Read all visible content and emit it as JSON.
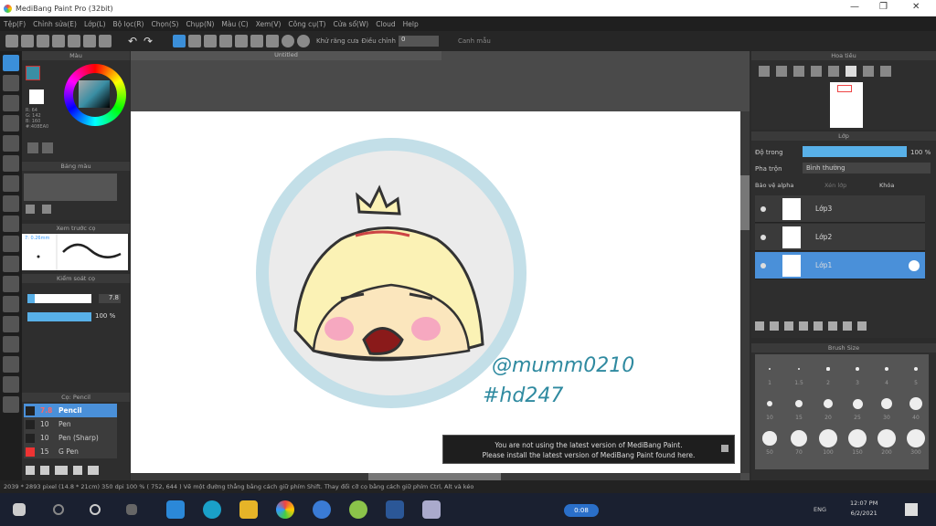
{
  "window": {
    "title": "MediBang Paint Pro (32bit)",
    "controls": [
      "—",
      "❐",
      "✕"
    ]
  },
  "menu": [
    "Tệp(F)",
    "Chỉnh sửa(E)",
    "Lớp(L)",
    "Bộ lọc(R)",
    "Chọn(S)",
    "Chụp(N)",
    "Màu (C)",
    "Xem(V)",
    "Công cụ(T)",
    "Cửa sổ(W)",
    "Cloud",
    "Help"
  ],
  "toolbar": {
    "antialias_label": "Khử răng cưa",
    "correction_label": "Điều chỉnh",
    "correction_value": "0",
    "snap_label": "Canh mẫu"
  },
  "document": {
    "tab": "Untitled",
    "signature_line1": "@mumm0210",
    "signature_line2": "#hd247"
  },
  "color_panel": {
    "title": "Màu",
    "r": "R: 64",
    "g": "G: 142",
    "b": "B: 160",
    "hex": "#:408EA0",
    "primary": "#3a8ea4"
  },
  "palette_panel": {
    "title": "Bảng màu"
  },
  "brush_preview_panel": {
    "title": "Xem trước cọ",
    "brush": "7: 0.26mm"
  },
  "brush_control_panel": {
    "title": "Kiểm soát cọ",
    "size": "7.8",
    "opacity": "100 %",
    "size_fraction": 0.12,
    "opacity_fraction": 1.0
  },
  "brush_panel": {
    "title": "Cọ: Pencil",
    "items": [
      {
        "size": "7.8",
        "name": "Pencil",
        "color": "#222",
        "selected": true
      },
      {
        "size": "10",
        "name": "Pen",
        "color": "#222"
      },
      {
        "size": "10",
        "name": "Pen (Sharp)",
        "color": "#222"
      },
      {
        "size": "15",
        "name": "G Pen",
        "color": "#e33"
      }
    ]
  },
  "navigator_panel": {
    "title": "Hoa tiêu"
  },
  "layer_panel": {
    "title": "Lớp",
    "opacity_label": "Độ trong",
    "opacity": "100 %",
    "blend_label": "Pha trộn",
    "blend": "Bình thường",
    "protect_alpha": "Bảo vệ alpha",
    "clipping": "Xén lớp",
    "lock": "Khóa",
    "layers": [
      {
        "name": "Lớp3",
        "selected": false
      },
      {
        "name": "Lớp2",
        "selected": false
      },
      {
        "name": "Lớp1",
        "selected": true
      }
    ]
  },
  "brush_size_panel": {
    "title": "Brush Size",
    "sizes": [
      "1",
      "1.5",
      "2",
      "3",
      "4",
      "5",
      "10",
      "15",
      "20",
      "25",
      "30",
      "40",
      "50",
      "70",
      "100",
      "150",
      "200",
      "300"
    ]
  },
  "notice": {
    "line1": "You are not using the latest version of MediBang Paint.",
    "line2": "Please install the latest version of MediBang Paint found here."
  },
  "statusbar": {
    "text": "2039 * 2893 pixel  (14.8 * 21cm)  350 dpi  100 %  ( 752, 644 )  Vẽ một đường thẳng bằng cách giữ phím Shift. Thay đổi cỡ cọ bằng cách giữ phím Ctrl, Alt và kéo"
  },
  "taskbar": {
    "timer": "0:08",
    "lang": "ENG",
    "time": "12:07 PM",
    "date": "6/2/2021"
  }
}
